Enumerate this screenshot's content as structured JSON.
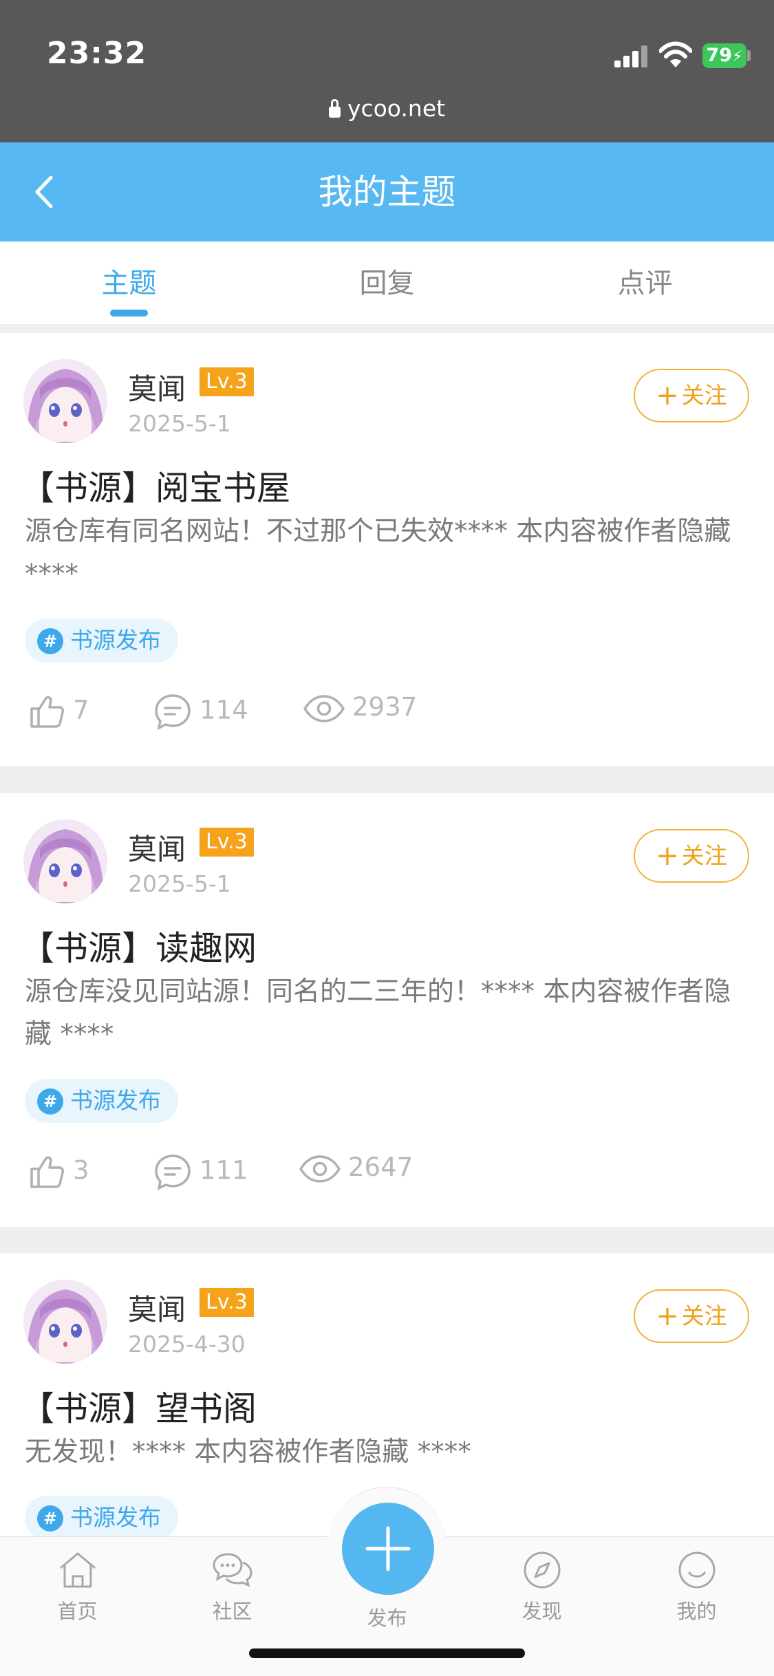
{
  "status_bar": {
    "time": "23:32",
    "battery": "79"
  },
  "browser": {
    "url": "ycoo.net"
  },
  "header": {
    "title": "我的主题"
  },
  "tabs": [
    {
      "label": "主题"
    },
    {
      "label": "回复"
    },
    {
      "label": "点评"
    }
  ],
  "posts": [
    {
      "author": "莫闻",
      "level": "Lv.3",
      "date": "2025-5-1",
      "follow_label": "关注",
      "title": "【书源】阅宝书屋",
      "excerpt": "源仓库有同名网站！不过那个已失效**** 本内容被作者隐藏 ****",
      "tag": "书源发布",
      "likes": "7",
      "comments": "114",
      "views": "2937"
    },
    {
      "author": "莫闻",
      "level": "Lv.3",
      "date": "2025-5-1",
      "follow_label": "关注",
      "title": "【书源】读趣网",
      "excerpt": "源仓库没见同站源！同名的二三年的！**** 本内容被作者隐藏 ****",
      "tag": "书源发布",
      "likes": "3",
      "comments": "111",
      "views": "2647"
    },
    {
      "author": "莫闻",
      "level": "Lv.3",
      "date": "2025-4-30",
      "follow_label": "关注",
      "title": "【书源】望书阁",
      "excerpt": "无发现！**** 本内容被作者隐藏 ****",
      "tag": "书源发布"
    }
  ],
  "nav": [
    {
      "label": "首页",
      "icon": "home-icon"
    },
    {
      "label": "社区",
      "icon": "community-icon"
    },
    {
      "label": "发布",
      "icon": "plus-icon"
    },
    {
      "label": "发现",
      "icon": "compass-icon"
    },
    {
      "label": "我的",
      "icon": "profile-icon"
    }
  ],
  "colors": {
    "accent": "#57b8f2",
    "level_badge": "#f5a31a",
    "follow": "#eea21b"
  }
}
